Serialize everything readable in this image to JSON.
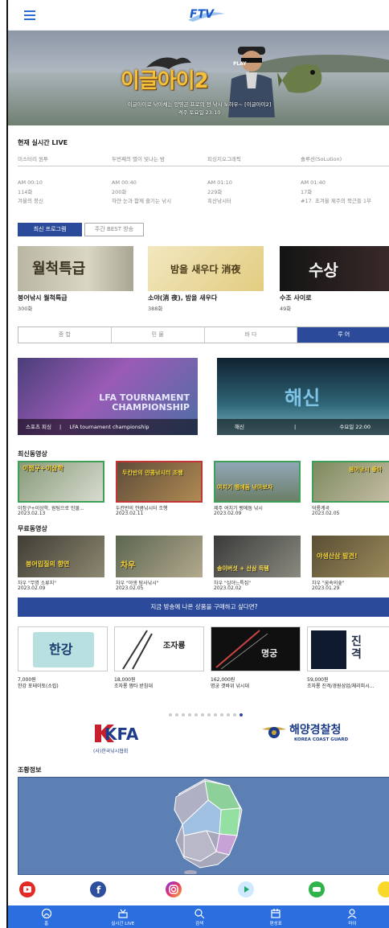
{
  "header": {
    "logo": "FTV"
  },
  "hero": {
    "title": "이글아이2",
    "badge": "PLAY",
    "caption_line1": "이글아이로 낚아채는 양영곤 프로의 전 낚시 노하우~ [이글아이2]",
    "caption_line2": "격주 토요일 23:10",
    "slides": 4,
    "active_slide": 1
  },
  "live": {
    "title": "현재 실시간 LIVE",
    "now": [
      "미스터리 원투",
      "두번째의 별이 빛나는 밤",
      "피싱지오그래픽",
      "솔루션(SoLution)"
    ],
    "next": [
      {
        "time": "AM 00:10",
        "episode": "114화",
        "title": "겨울의 붕신"
      },
      {
        "time": "AM 00:40",
        "episode": "200화",
        "title": "하얀 눈과 함께 즐기는 낚시"
      },
      {
        "time": "AM 01:10",
        "episode": "229화",
        "title": "흑산낚시터"
      },
      {
        "time": "AM 01:40",
        "episode": "17화",
        "title": "#17. 초겨울 제주의 묵근들 1부"
      }
    ]
  },
  "programs": {
    "tab_latest": "최신 프로그램",
    "tab_best": "주간 BEST 방송",
    "items": [
      {
        "name": "붕어낚시 월척특급",
        "episodes": "300화",
        "thumb_text": "월척특급"
      },
      {
        "name": "소야(消 夜), 밤을 새우다",
        "episodes": "388화",
        "thumb_text": "밤을 새우다 消夜"
      },
      {
        "name": "수조 사이로",
        "episodes": "49화",
        "thumb_text": "수상"
      }
    ]
  },
  "categories": [
    "종 합",
    "민 물",
    "바 다",
    "루 어"
  ],
  "active_category": 3,
  "features": [
    {
      "overlay": "LFA TOURNAMENT CHAMPIONSHIP",
      "caption_left": "스포츠 피싱",
      "caption_right": "LFA tournament championship"
    },
    {
      "overlay": "해신",
      "caption_left": "해신",
      "caption_right": "수요일 22:00"
    }
  ],
  "latest_videos": {
    "title": "최신동영상",
    "items": [
      {
        "title": "이정구+이상학, 원팀으로 민물...",
        "date": "2023.02.13",
        "thumb": "이정구+이상학"
      },
      {
        "title": "두칸반의 얀콤낚시터 조행",
        "date": "2023.02.11",
        "thumb": "두칸반의 얀콤낚시터 조행"
      },
      {
        "title": "제주 여치기 벵에돔 낚시",
        "date": "2023.02.09",
        "thumb": "여치기 벵에돔 낚아보자"
      },
      {
        "title": "덕룡계곡",
        "date": "2023.02.05",
        "thumb": "붕어낚시 좋아"
      }
    ]
  },
  "free_videos": {
    "title": "무료동영상",
    "items": [
      {
        "title": "차우 \"무명 소류지\"",
        "date": "2023.02.09",
        "thumb": "붕어입질의 향연"
      },
      {
        "title": "차우 \"야생 탐사낚시\"",
        "date": "2023.02.05",
        "thumb": "차우"
      },
      {
        "title": "차우 \"심야느특집\"",
        "date": "2023.02.02",
        "thumb": "송이버섯 + 산삼 득템"
      },
      {
        "title": "차우 \"꿈속의숲\"",
        "date": "2023.01.29",
        "thumb": "야생산삼 발견!"
      }
    ]
  },
  "shop": {
    "banner": "지금 방송에 나온 상품을 구매하고 싶다면?",
    "products": [
      {
        "price": "7,000원",
        "name": "한강 포테이토(소립)",
        "thumb": "한강"
      },
      {
        "price": "18,000원",
        "name": "조자룡 짬타 받침대",
        "thumb": "조자룡"
      },
      {
        "price": "162,000원",
        "name": "명궁 갯바위 낚시대",
        "thumb": "명궁"
      },
      {
        "price": "59,000원",
        "name": "조자룡 진격/경원삼업/체리피시...",
        "thumb": "진격"
      }
    ],
    "pages": 12,
    "active_page": 11
  },
  "partners": {
    "kfa_logo": "KFA",
    "kfa_name": "(사)한국낚시협회",
    "kcg_name": "해양경찰청",
    "kcg_sub": "KOREA COAST GUARD"
  },
  "tide": {
    "title": "조황정보"
  },
  "social_icons": [
    "youtube-icon",
    "facebook-icon",
    "instagram-icon",
    "play-icon",
    "chat-icon",
    "kakao-icon"
  ],
  "colors": {
    "brand": "#2b4a99",
    "nav": "#2a6ee0"
  },
  "bottom_nav": [
    {
      "label": "홈",
      "icon": "home-icon"
    },
    {
      "label": "실시간 LIVE",
      "icon": "live-icon"
    },
    {
      "label": "검색",
      "icon": "search-icon"
    },
    {
      "label": "편성표",
      "icon": "calendar-icon"
    },
    {
      "label": "마이",
      "icon": "user-icon"
    }
  ]
}
